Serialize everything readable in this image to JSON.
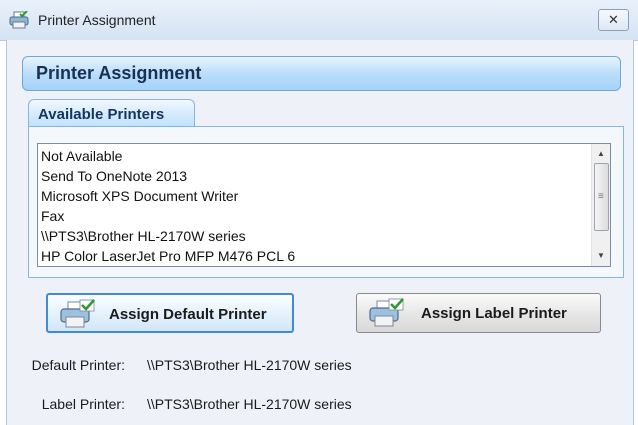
{
  "window": {
    "title": "Printer Assignment",
    "close_glyph": "✕",
    "icon": "printer-icon"
  },
  "header": {
    "title": "Printer Assignment"
  },
  "tab": {
    "label": "Available Printers"
  },
  "printers": {
    "items": [
      "Not Available",
      "Send To OneNote 2013",
      "Microsoft XPS Document Writer",
      "Fax",
      "\\\\PTS3\\Brother HL-2170W series",
      "HP Color LaserJet Pro MFP M476 PCL 6"
    ]
  },
  "buttons": {
    "assign_default": "Assign Default Printer",
    "assign_label": "Assign Label Printer",
    "icon": "printer-check-icon"
  },
  "info": {
    "default_label": "Default Printer:",
    "default_value": "\\\\PTS3\\Brother HL-2170W series",
    "label_label": "Label Printer:",
    "label_value": "\\\\PTS3\\Brother HL-2170W series"
  },
  "colors": {
    "accent": "#3f8cd3",
    "header_bg": "#b7dcfa",
    "check": "#2e9a2e"
  }
}
